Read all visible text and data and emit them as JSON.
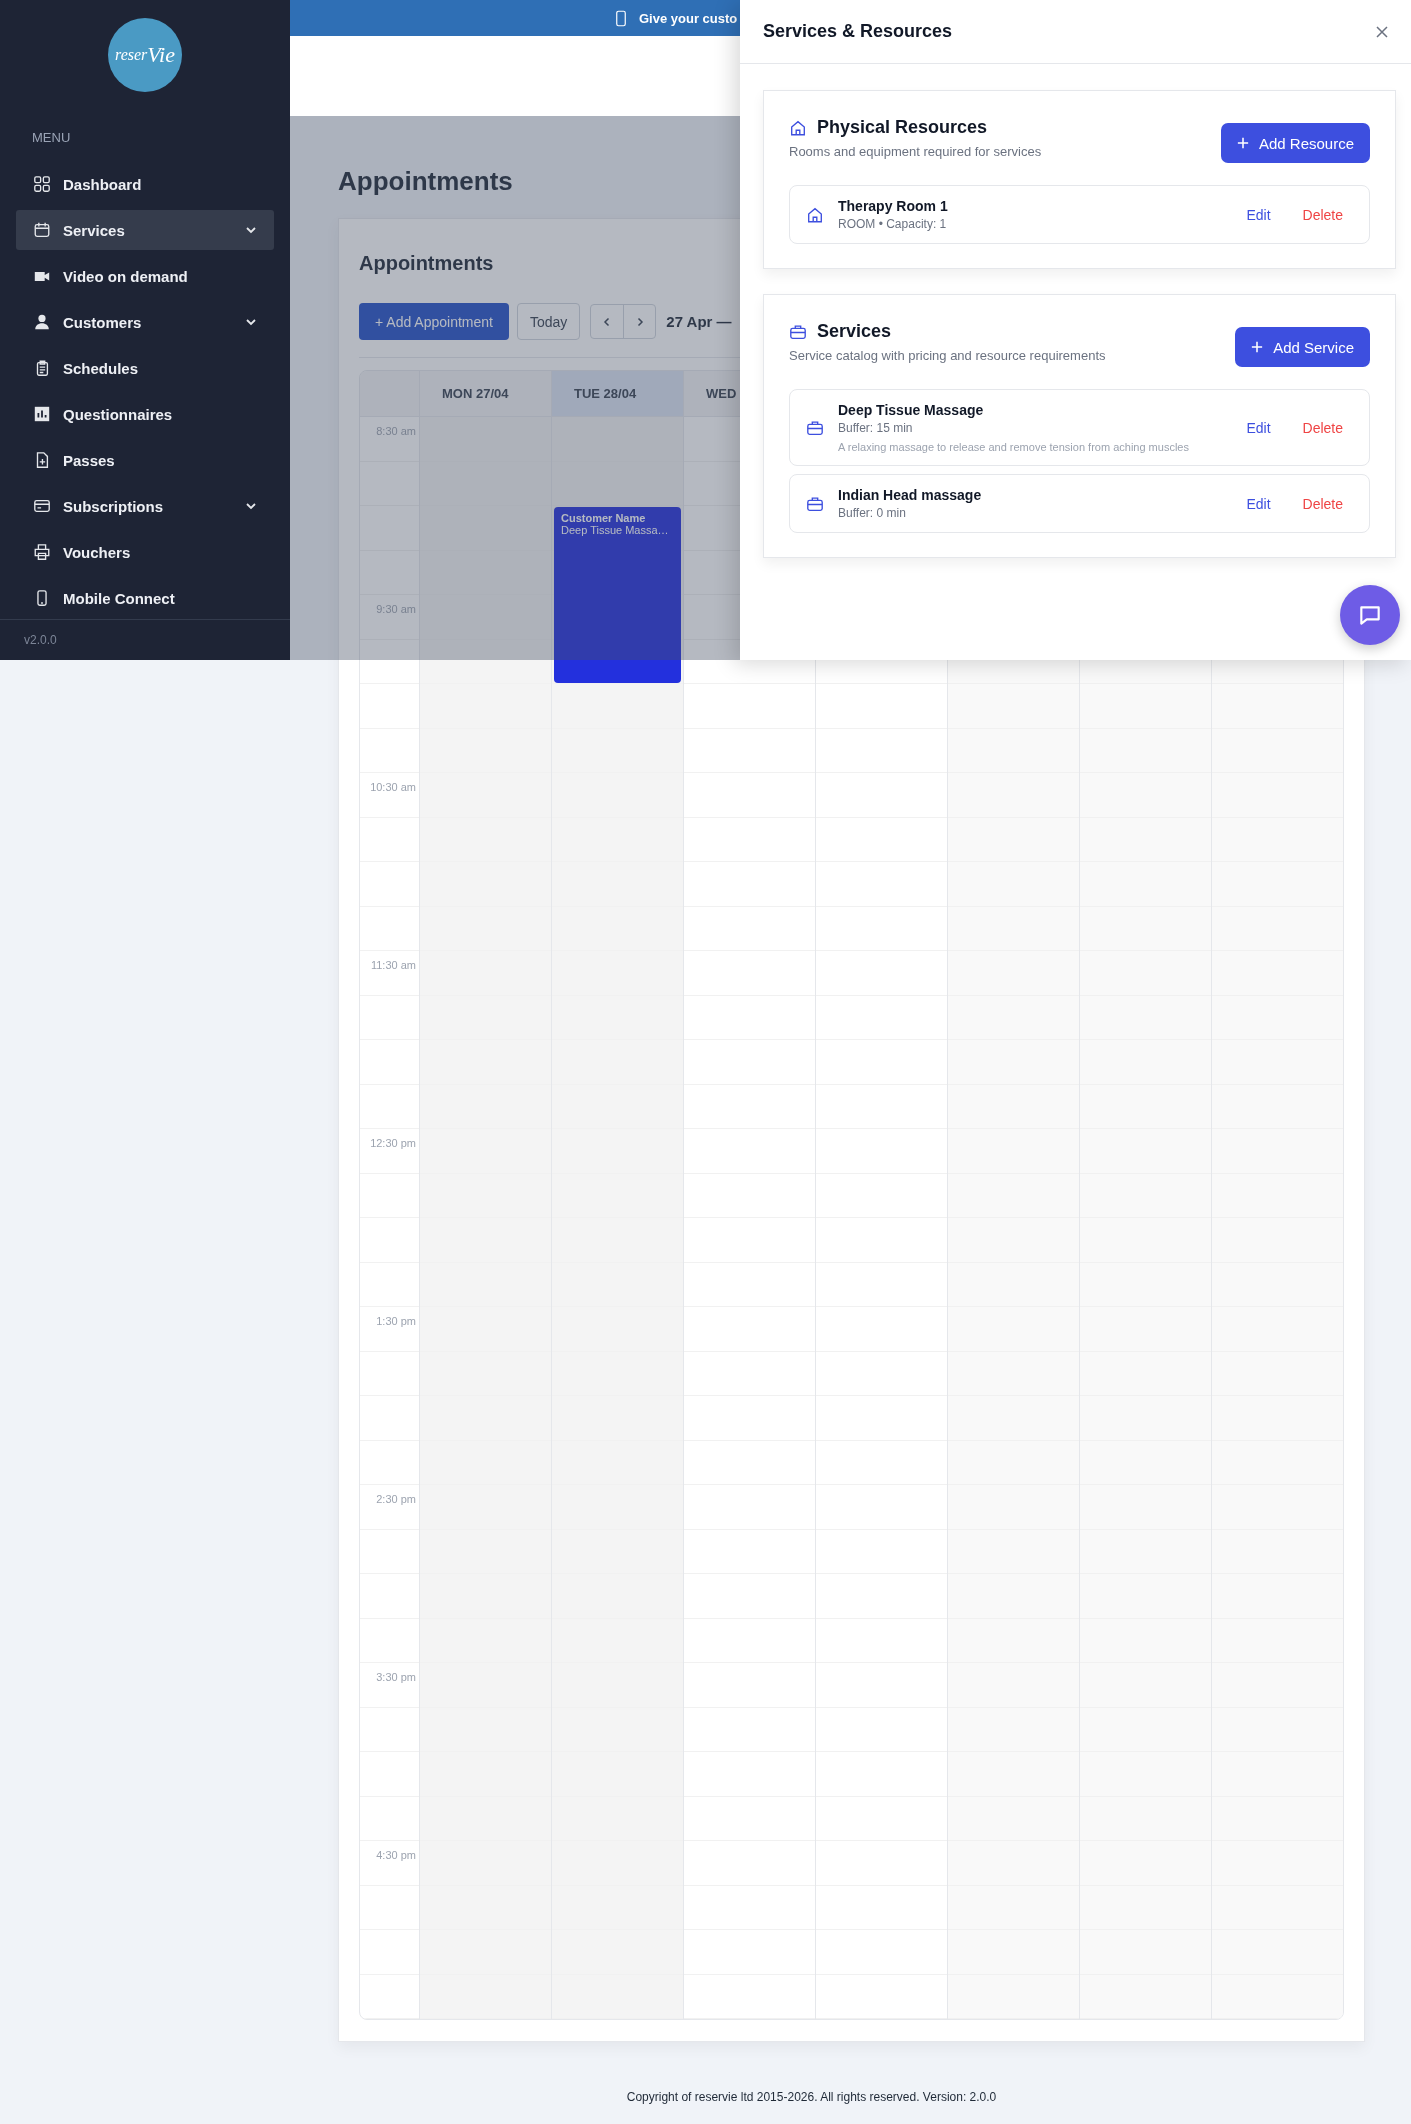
{
  "banner": {
    "text": "Give your custo"
  },
  "sidebar": {
    "logo_left": "reser",
    "logo_right": "Vie",
    "menu_label": "MENU",
    "items": [
      {
        "label": "Dashboard",
        "selected": false,
        "expandable": false
      },
      {
        "label": "Services",
        "selected": true,
        "expandable": true
      },
      {
        "label": "Video on demand",
        "selected": false,
        "expandable": false
      },
      {
        "label": "Customers",
        "selected": false,
        "expandable": true
      },
      {
        "label": "Schedules",
        "selected": false,
        "expandable": false
      },
      {
        "label": "Questionnaires",
        "selected": false,
        "expandable": false
      },
      {
        "label": "Passes",
        "selected": false,
        "expandable": false
      },
      {
        "label": "Subscriptions",
        "selected": false,
        "expandable": true
      },
      {
        "label": "Vouchers",
        "selected": false,
        "expandable": false
      },
      {
        "label": "Mobile Connect",
        "selected": false,
        "expandable": false
      }
    ],
    "version": "v2.0.0"
  },
  "page": {
    "title": "Appointments"
  },
  "calendar": {
    "title": "Appointments",
    "add_button": "+ Add Appointment",
    "today_button": "Today",
    "range": "27 Apr —",
    "days": [
      {
        "label": "MON 27/04",
        "kind": "past",
        "selected": false
      },
      {
        "label": "TUE 28/04",
        "kind": "past",
        "selected": true,
        "appointments": [
          {
            "customer": "Customer Name",
            "service": "Deep Tissue Massa…"
          }
        ]
      },
      {
        "label": "WED",
        "kind": "open",
        "selected": false
      },
      {
        "kind": "open"
      },
      {
        "kind": "closed"
      },
      {
        "kind": "closed"
      },
      {
        "kind": "closed"
      }
    ],
    "times": [
      "8:30 am",
      "9:30 am",
      "10:30 am",
      "11:30 am",
      "12:30 pm",
      "1:30 pm",
      "2:30 pm",
      "3:30 pm",
      "4:30 pm"
    ]
  },
  "panel": {
    "title": "Services & Resources",
    "sections": [
      {
        "kind": "resources",
        "title": "Physical Resources",
        "subtitle": "Rooms and equipment required for services",
        "add_button": "Add Resource",
        "items": [
          {
            "name": "Therapy Room 1",
            "meta": "ROOM • Capacity: 1",
            "edit": "Edit",
            "delete": "Delete"
          }
        ]
      },
      {
        "kind": "services",
        "title": "Services",
        "subtitle": "Service catalog with pricing and resource requirements",
        "add_button": "Add Service",
        "items": [
          {
            "name": "Deep Tissue Massage",
            "meta": "Buffer: 15 min",
            "description": "A relaxing massage to release and remove tension from aching muscles",
            "edit": "Edit",
            "delete": "Delete"
          },
          {
            "name": "Indian Head massage",
            "meta": "Buffer: 0 min",
            "edit": "Edit",
            "delete": "Delete"
          }
        ]
      }
    ]
  },
  "footer": {
    "text": "Copyright of reservie ltd 2015-2026. All rights reserved. Version: 2.0.0"
  }
}
